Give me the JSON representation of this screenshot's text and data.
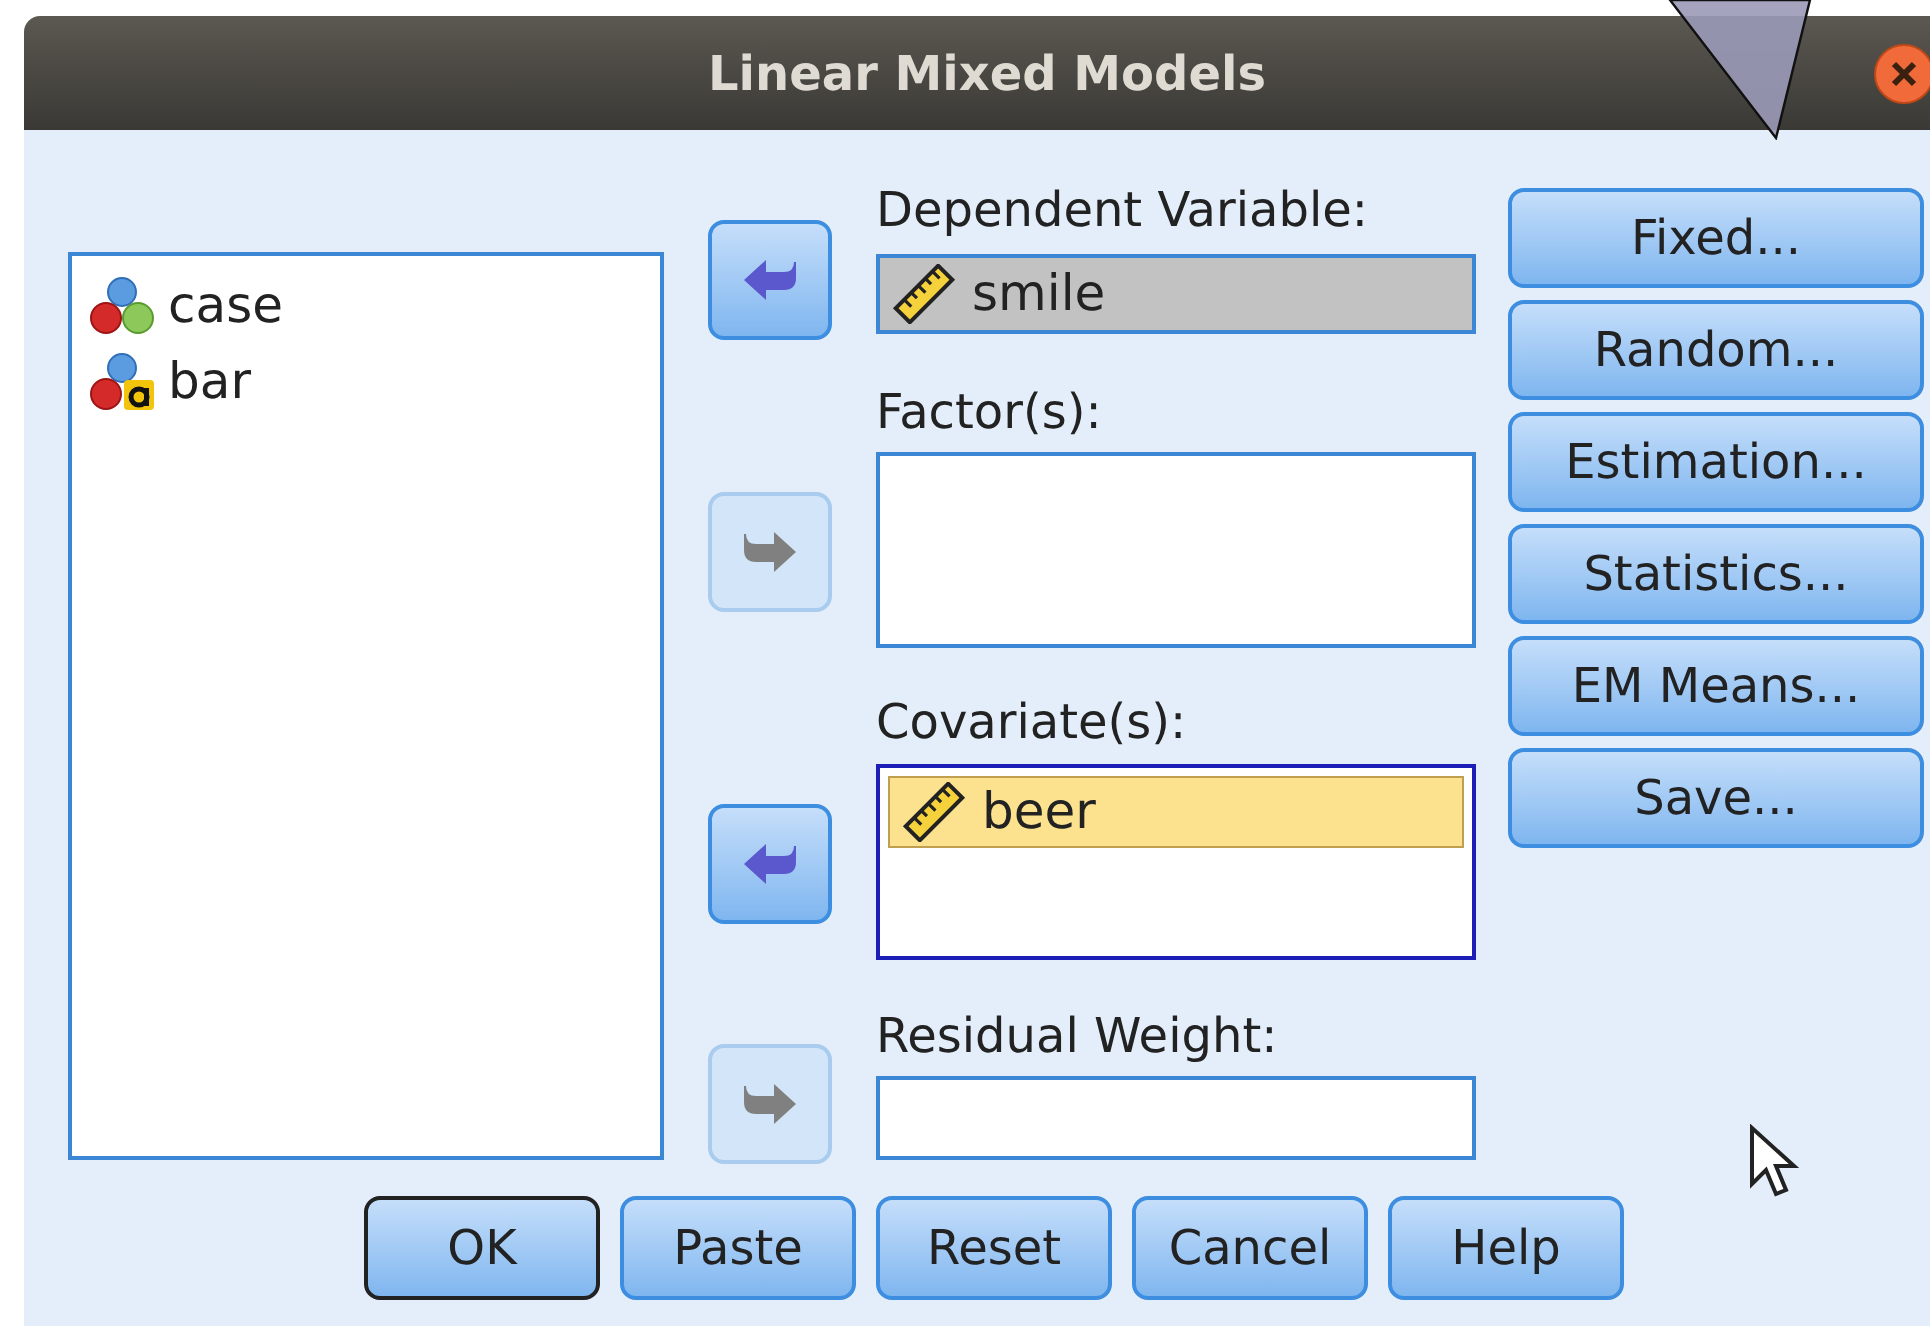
{
  "window": {
    "title": "Linear Mixed Models"
  },
  "variables": [
    {
      "name": "case",
      "kind": "nominal"
    },
    {
      "name": "bar",
      "kind": "string"
    }
  ],
  "arrow_buttons": [
    {
      "kind": "left",
      "disabled": false
    },
    {
      "kind": "right",
      "disabled": true
    },
    {
      "kind": "left",
      "disabled": false
    },
    {
      "kind": "right",
      "disabled": true
    }
  ],
  "targets": [
    {
      "label": "Dependent Variable:",
      "focused": false,
      "filled": true,
      "items": [
        {
          "name": "smile",
          "kind": "scale",
          "selected": false
        }
      ]
    },
    {
      "label": "Factor(s):",
      "focused": false,
      "filled": false
    },
    {
      "label": "Covariate(s):",
      "focused": true,
      "filled": false,
      "items": [
        {
          "name": "beer",
          "kind": "scale",
          "selected": true
        }
      ]
    },
    {
      "label": "Residual Weight:",
      "focused": false,
      "filled": false
    }
  ],
  "side_buttons": [
    {
      "label": "Fixed..."
    },
    {
      "label": "Random..."
    },
    {
      "label": "Estimation..."
    },
    {
      "label": "Statistics..."
    },
    {
      "label": "EM Means..."
    },
    {
      "label": "Save..."
    }
  ],
  "bottom_buttons": [
    {
      "label": "OK",
      "default": true
    },
    {
      "label": "Paste",
      "default": false
    },
    {
      "label": "Reset",
      "default": false
    },
    {
      "label": "Cancel",
      "default": false
    },
    {
      "label": "Help",
      "default": false
    }
  ]
}
